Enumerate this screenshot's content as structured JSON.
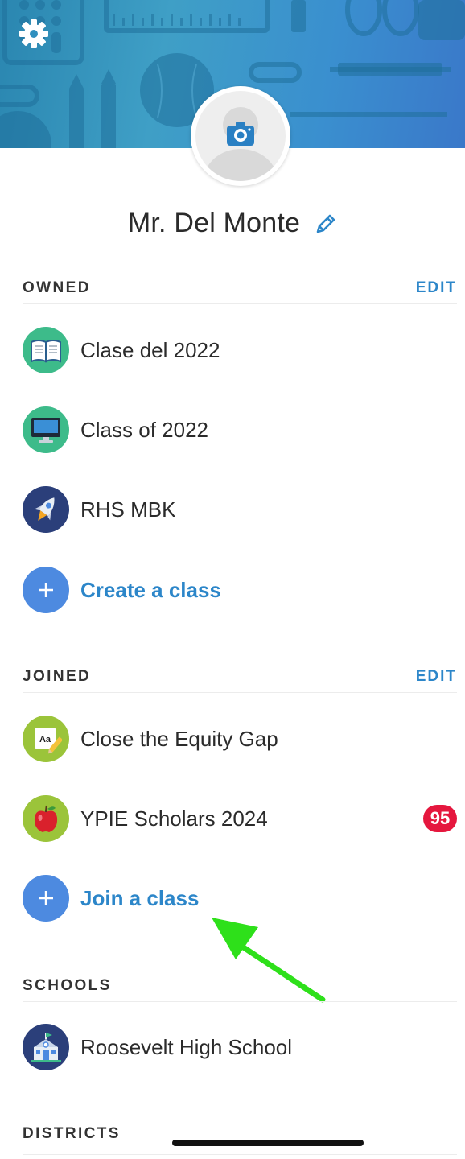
{
  "profile": {
    "name": "Mr. Del Monte"
  },
  "header": {
    "banner_colors": [
      "#2a86b0",
      "#3a78c9"
    ]
  },
  "sections": {
    "owned": {
      "title": "OWNED",
      "edit_label": "EDIT",
      "items": [
        {
          "label": "Clase del 2022",
          "icon": "open-book-icon",
          "color": "#3dbb8a"
        },
        {
          "label": "Class of 2022",
          "icon": "desktop-computer-icon",
          "color": "#3dbb8a"
        },
        {
          "label": "RHS MBK",
          "icon": "rocket-icon",
          "color": "#2b3f7a"
        }
      ],
      "action_label": "Create a class"
    },
    "joined": {
      "title": "JOINED",
      "edit_label": "EDIT",
      "items": [
        {
          "label": "Close the Equity Gap",
          "icon": "notepad-pencil-icon",
          "color": "#9bc43a",
          "glyph": "Aa"
        },
        {
          "label": "YPIE Scholars 2024",
          "icon": "apple-icon",
          "color": "#9bc43a",
          "badge": "95"
        }
      ],
      "action_label": "Join a class"
    },
    "schools": {
      "title": "SCHOOLS",
      "items": [
        {
          "label": "Roosevelt High School",
          "icon": "school-building-icon",
          "color": "#2b3f7a"
        }
      ]
    },
    "districts": {
      "title": "DISTRICTS"
    }
  },
  "colors": {
    "accent": "#2c86c9",
    "plus_button": "#4d8ae0",
    "badge": "#e5173e",
    "annotation_arrow": "#2ee01a"
  }
}
